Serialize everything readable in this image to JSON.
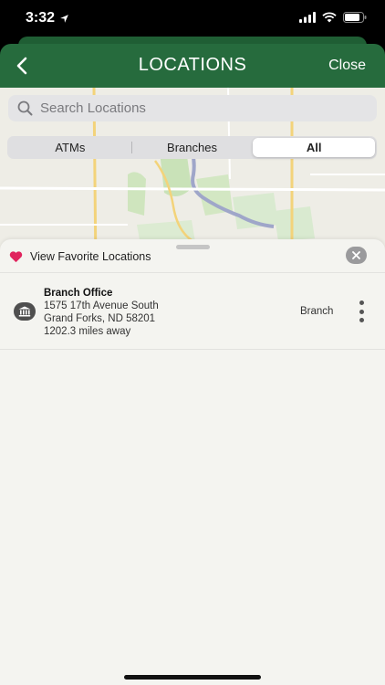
{
  "status_bar": {
    "time": "3:32"
  },
  "header": {
    "title": "LOCATIONS",
    "close_label": "Close"
  },
  "search": {
    "placeholder": "Search Locations",
    "value": ""
  },
  "filter_tabs": [
    {
      "label": "ATMs",
      "selected": false
    },
    {
      "label": "Branches",
      "selected": false
    },
    {
      "label": "All",
      "selected": true
    }
  ],
  "sheet": {
    "favorites_label": "View Favorite Locations",
    "locations": [
      {
        "name": "Branch Office",
        "address_line1": "1575 17th Avenue South",
        "address_line2": "Grand Forks, ND 58201",
        "distance": "1202.3 miles away",
        "type": "Branch"
      }
    ]
  },
  "colors": {
    "header_green": "#266b3d",
    "favorite_heart": "#e0245e"
  }
}
